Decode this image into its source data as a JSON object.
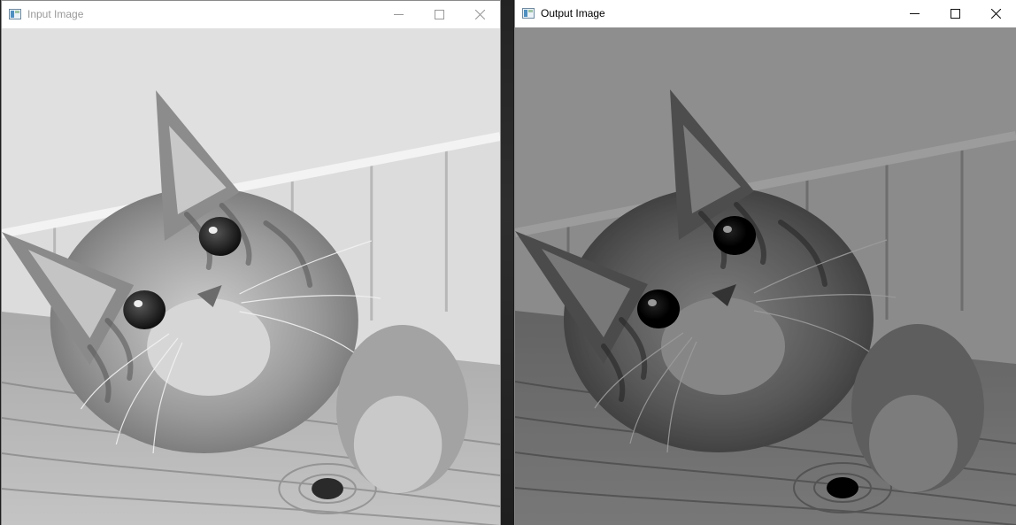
{
  "windows": [
    {
      "title": "Input Image",
      "image_icon": "cat-photo",
      "controls": {
        "minimize_icon": "minimize-icon",
        "maximize_icon": "maximize-icon",
        "close_icon": "close-icon"
      },
      "focused": false
    },
    {
      "title": "Output Image",
      "image_icon": "cat-photo",
      "controls": {
        "minimize_icon": "minimize-icon",
        "maximize_icon": "maximize-icon",
        "close_icon": "close-icon"
      },
      "focused": true
    }
  ]
}
